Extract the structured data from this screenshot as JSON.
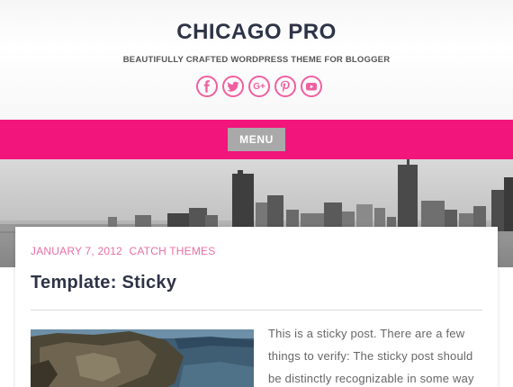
{
  "site": {
    "title": "CHICAGO PRO",
    "tagline": "BEAUTIFULLY CRAFTED WORDPRESS THEME FOR BLOGGER"
  },
  "social": [
    {
      "name": "facebook-icon",
      "glyph": "f"
    },
    {
      "name": "twitter-icon",
      "glyph": ""
    },
    {
      "name": "google-plus-icon",
      "glyph": "G+"
    },
    {
      "name": "pinterest-icon",
      "glyph": ""
    },
    {
      "name": "youtube-icon",
      "glyph": ""
    }
  ],
  "menu": {
    "label": "MENU"
  },
  "post": {
    "date": "JANUARY 7, 2012",
    "author": "CATCH THEMES",
    "title": "Template: Sticky",
    "excerpt": "This is a sticky post. There are a few things to verify: The sticky post should be distinctly recognizable in some way"
  },
  "colors": {
    "accent": "#f2157b",
    "social": "#f05fa0",
    "meta": "#e86fa6",
    "title": "#2e3447",
    "menu_button": "#a9a9a9"
  }
}
